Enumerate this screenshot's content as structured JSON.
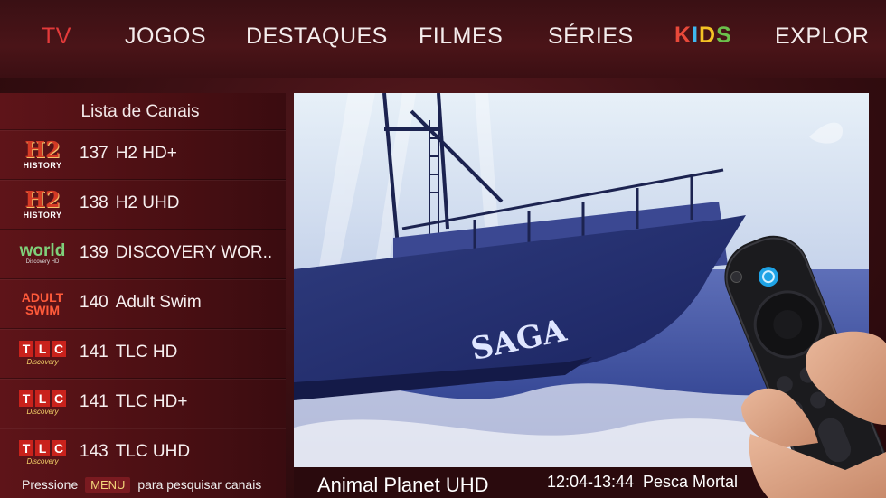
{
  "nav": {
    "tabs": [
      "TV",
      "JOGOS",
      "DESTAQUES",
      "FILMES",
      "SÉRIES",
      "KIDS",
      "EXPLOR"
    ],
    "active_tab": "TV"
  },
  "channel_panel": {
    "title": "Lista de Canais",
    "channels": [
      {
        "number": "137",
        "name": "H2 HD+",
        "logo": "history-logo"
      },
      {
        "number": "138",
        "name": "H2 UHD",
        "logo": "history-logo"
      },
      {
        "number": "139",
        "name": "DISCOVERY WOR..",
        "logo": "discovery-world-logo"
      },
      {
        "number": "140",
        "name": "Adult Swim",
        "logo": "adult-swim-logo"
      },
      {
        "number": "141",
        "name": "TLC HD",
        "logo": "tlc-logo"
      },
      {
        "number": "141",
        "name": "TLC HD+",
        "logo": "tlc-logo"
      },
      {
        "number": "143",
        "name": "TLC UHD",
        "logo": "tlc-logo"
      }
    ],
    "logos": {
      "history_h2": "H2",
      "history_text": "HISTORY",
      "world_text": "world",
      "world_sub": "Discovery HD",
      "adult_line1": "ADULT",
      "adult_line2": "SWIM",
      "tlc_letters": [
        "T",
        "L",
        "C"
      ],
      "tlc_sub": "Discovery"
    },
    "footer": {
      "prefix": "Pressione",
      "key": "MENU",
      "suffix": "para pesquisar canais"
    }
  },
  "player": {
    "boat_name": "SAGA",
    "now_playing": {
      "channel": "Animal Planet UHD",
      "time": "12:04-13:44",
      "program": "Pesca Mortal"
    }
  },
  "colors": {
    "active_tab": "#e33a3a",
    "background": "#3d1014",
    "panel": "#4a0f13",
    "menu_key": "#f3d67a"
  }
}
